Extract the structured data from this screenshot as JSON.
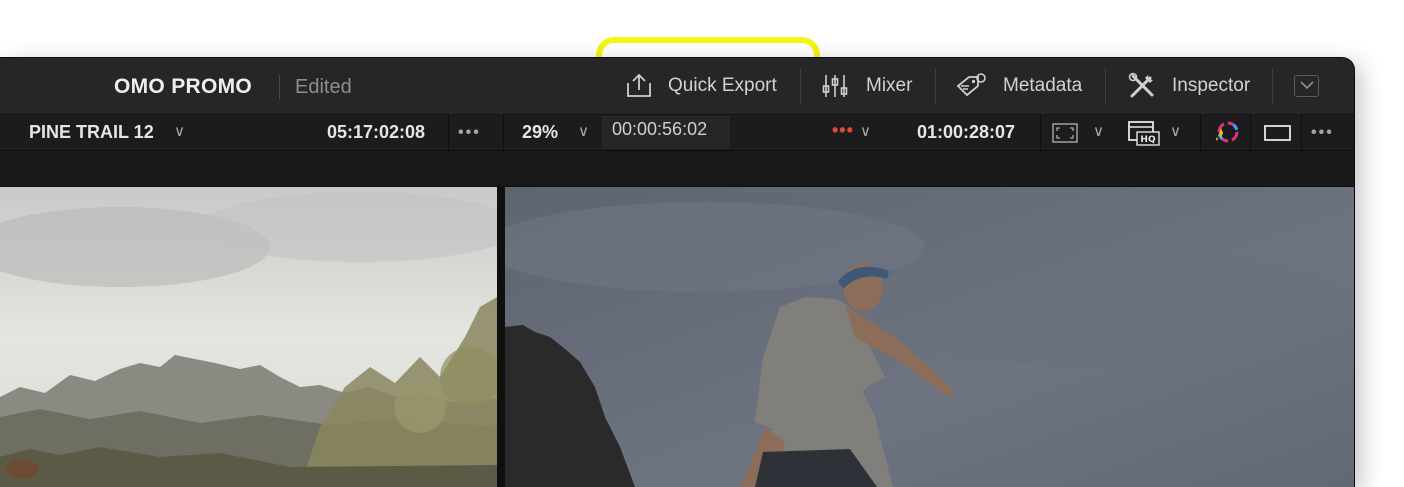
{
  "header": {
    "project_title": "OMO PROMO",
    "project_status": "Edited",
    "buttons": [
      {
        "label": "Quick Export",
        "icon": "export-icon"
      },
      {
        "label": "Mixer",
        "icon": "mixer-icon"
      },
      {
        "label": "Metadata",
        "icon": "metadata-tag-icon"
      },
      {
        "label": "Inspector",
        "icon": "inspector-tools-icon"
      }
    ],
    "collapse_icon": "chevron-down-icon",
    "highlight_color": "#f5f516"
  },
  "viewer_bar": {
    "source_clip_name": "PINE TRAIL 12",
    "source_timecode": "05:17:02:08",
    "more_glyph": "•••",
    "zoom_level": "29%",
    "playhead_timecode": "00:00:56:02",
    "timeline_timecode": "01:00:28:07",
    "chevron_glyph": "∨",
    "icons": [
      "fullscreen-icon",
      "hq-playback-icon",
      "color-wheel-icon",
      "viewer-mode-icon"
    ]
  },
  "viewers": {
    "source": "source-viewer",
    "timeline": "timeline-viewer"
  }
}
